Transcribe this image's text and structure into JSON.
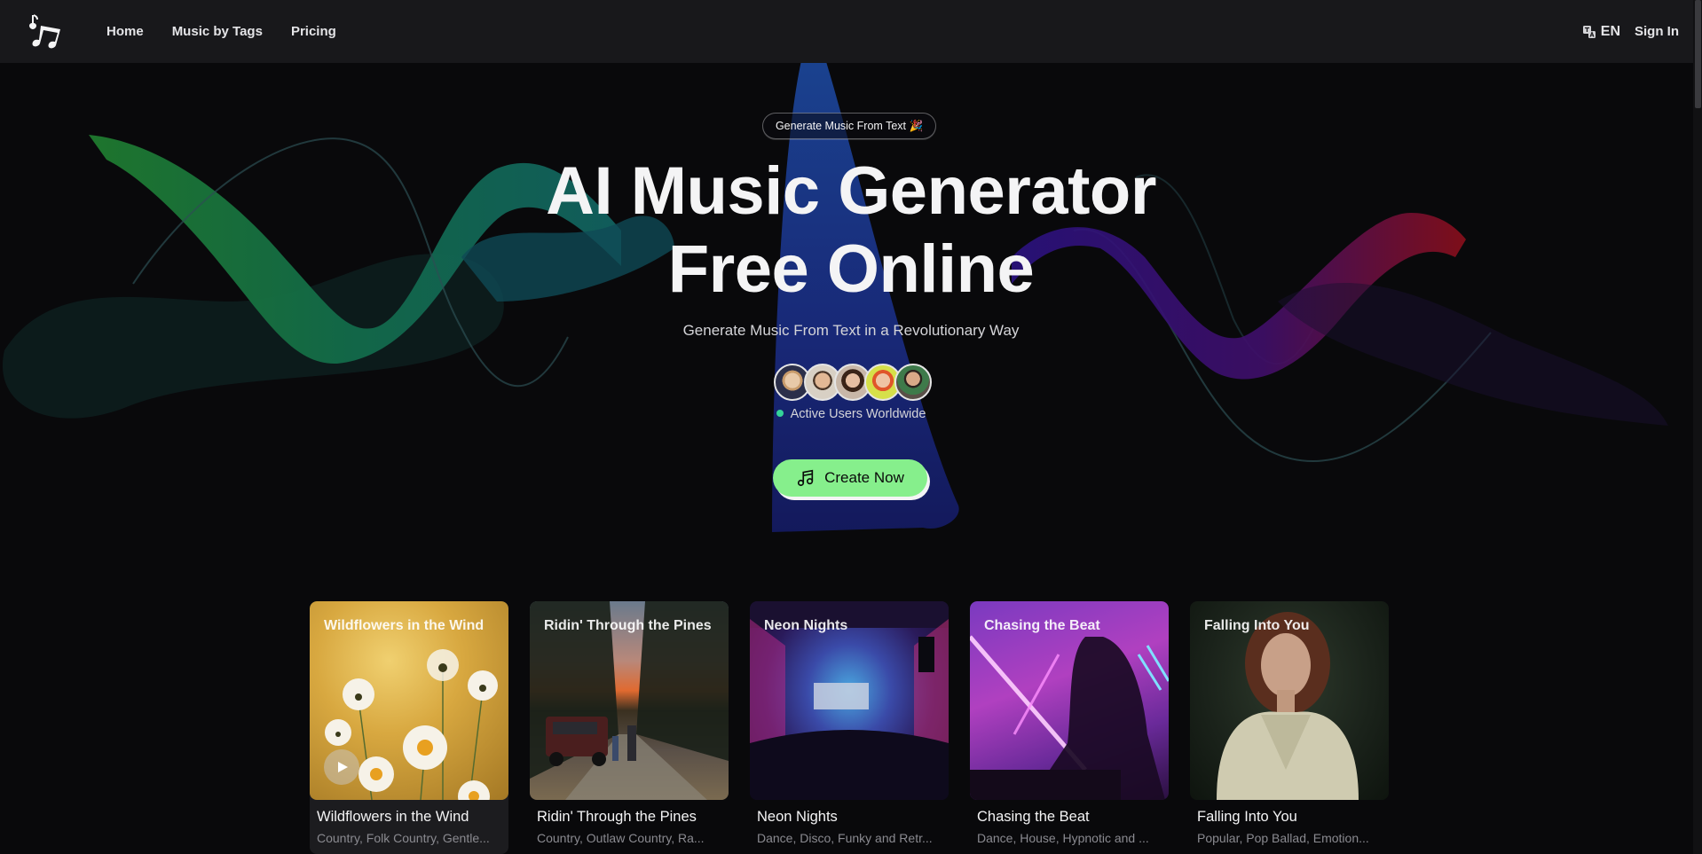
{
  "header": {
    "logo_icon": "music-notes-icon",
    "nav": [
      {
        "label": "Home"
      },
      {
        "label": "Music by Tags"
      },
      {
        "label": "Pricing"
      }
    ],
    "language": {
      "icon": "translate-icon",
      "label": "EN"
    },
    "signin_label": "Sign In"
  },
  "hero": {
    "pill_label": "Generate Music From Text 🎉",
    "title_line1": "AI Music Generator",
    "title_line2": "Free Online",
    "subtitle": "Generate Music From Text in a Revolutionary Way",
    "avatars_count": 5,
    "active_users_label": "Active Users Worldwide",
    "active_dot_color": "#34d399",
    "cta_label": "Create Now",
    "cta_icon": "music-note-icon",
    "cta_color": "#86ef8c"
  },
  "cards": [
    {
      "title": "Wildflowers in the Wind",
      "tags": "Country, Folk Country, Gentle...",
      "hovered": true
    },
    {
      "title": "Ridin' Through the Pines",
      "tags": "Country, Outlaw Country, Ra..."
    },
    {
      "title": "Neon Nights",
      "tags": "Dance, Disco, Funky and Retr..."
    },
    {
      "title": "Chasing the Beat",
      "tags": "Dance, House, Hypnotic and ..."
    },
    {
      "title": "Falling Into You",
      "tags": "Popular, Pop Ballad, Emotion..."
    }
  ]
}
